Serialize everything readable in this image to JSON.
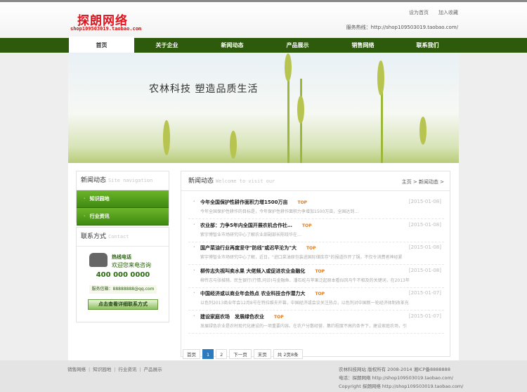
{
  "header": {
    "logo_text": "探朗网络",
    "logo_url": "shop109503019.taobao.com",
    "links": [
      "设为首页",
      "加入收藏"
    ],
    "hotline": "服务热线：http://shop109503019.taobao.com/"
  },
  "nav": [
    "首页",
    "关于企业",
    "新闻动态",
    "产品展示",
    "销售网络",
    "联系我们"
  ],
  "banner": {
    "slogan": "农林科技  塑造品质生活"
  },
  "sidebar": {
    "news_title": "新闻动态",
    "news_sub": "Site navigation",
    "links": [
      "知识园地",
      "行业资讯"
    ],
    "contact_title": "联系方式",
    "contact_sub": "Contact",
    "hot_label": "热线电话",
    "welcome": "欢迎您来电咨询",
    "phone": "400 000 0000",
    "email": "服务信箱：88888888@qq.com",
    "more_button": "点击查看详细联系方式"
  },
  "main": {
    "title": "新闻动态",
    "sub": "Welcome to visit our",
    "breadcrumb": "主页 > 新闻动态 >",
    "top_tag": "TOP",
    "news": [
      {
        "title": "今年全国保护性耕作面积力增1500万亩",
        "date": "[2015-01-08]",
        "summary": "今年全国保护性耕作的目标是，今年保护性耕作面积力争增加1500万亩，全国达到…"
      },
      {
        "title": "农业部：力争5年内全国开展农机合作社…",
        "date": "[2015-01-08]",
        "summary": "紫宇博智业市场研究中心了解农业部副部长陈晓华在…"
      },
      {
        "title": "国产菜油行业再度坚守\"防线\"或迟早沦为\"大",
        "date": "[2015-01-08]",
        "summary": "紫宇博智业市场研究中心了解，近日，\"进口菜油原包装进国际储库存\"的报道炸开了锅，不仅令消费者神经紧"
      },
      {
        "title": "柳传志失视叫卖水果 大佬频入或促进农业金融化",
        "date": "[2015-01-08]",
        "summary": "柳传志与张械桃、民生银行(行情,问诊)与金融鱼、潘石屹与苹果泛起原本看似风马牛不相及的关键词，在2013年"
      },
      {
        "title": "中国经济或以商业年会热点 农业科技合作潜力大",
        "date": "[2015-01-07]",
        "summary": "以色列2013商业年会12月8号在特拉维夫开幕，中国经济或会议关注热点，以色列对中国新一轮经济体制改革充"
      },
      {
        "title": "建设家庭农场　发展绿色农业",
        "date": "[2015-01-07]",
        "summary": "发展绿色农业是农村现代化建设的一项重要内容。在农户分散经营、集约程度不高的条件下，建设家庭农场，引"
      }
    ],
    "pager": {
      "first": "首页",
      "pages": [
        "1",
        "2"
      ],
      "next": "下一页",
      "last": "末页",
      "total": "共 2页8条"
    }
  },
  "footer": {
    "links": [
      "销售网络",
      "知识园地",
      "行业资讯",
      "产品展示"
    ],
    "copyright": "农林科技网站 版权所有 2008-2014 湘ICP备8888888",
    "tel": "电话：探朗网络 http://shop109503019.taobao.com/",
    "copy2": "Copyright 探朗网络 http://shop109503019.taobao.com/"
  }
}
